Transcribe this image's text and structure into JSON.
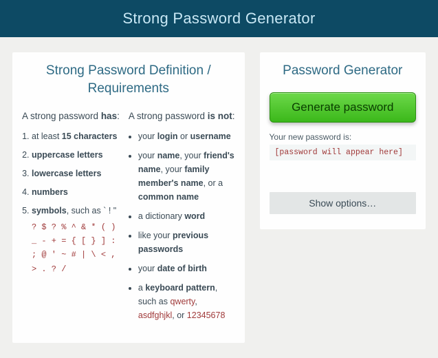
{
  "header": {
    "title": "Strong Password Generator"
  },
  "left": {
    "title": "Strong Password Definition / Requirements",
    "has": {
      "lead_prefix": "A strong password ",
      "lead_bold": "has",
      "lead_suffix": ":",
      "items": [
        {
          "pre": "at least ",
          "bold": "15 characters",
          "post": ""
        },
        {
          "pre": "",
          "bold": "uppercase letters",
          "post": ""
        },
        {
          "pre": "",
          "bold": "lowercase letters",
          "post": ""
        },
        {
          "pre": "",
          "bold": "numbers",
          "post": ""
        },
        {
          "pre": "",
          "bold": "symbols",
          "post": ", such as ` ! \""
        }
      ],
      "symbols_block": "? $ ? % ^ & * ( ) _ - + = { [ } ] : ; @ ' ~ # | \\ < , > . ? /"
    },
    "isnot": {
      "lead_prefix": "A strong password ",
      "lead_bold": "is not",
      "lead_suffix": ":",
      "items_html": [
        "your <b>login</b> or <b>username</b>",
        "your <b>name</b>, your <b>friend's name</b>, your <b>family member's name</b>, or a <b>common name</b>",
        "a dictionary <b>word</b>",
        "like your <b>previous passwords</b>",
        "your <b>date of birth</b>",
        "a <b>keyboard pattern</b>, such as <span class=\"ex\">qwerty</span>, <span class=\"ex\">asdfghjkl</span>, or <span class=\"ex\">12345678</span>"
      ]
    }
  },
  "right": {
    "title": "Password Generator",
    "generate_label": "Generate password",
    "pw_label": "Your new password is:",
    "pw_value": "[password will appear here]",
    "options_label": "Show options…"
  }
}
